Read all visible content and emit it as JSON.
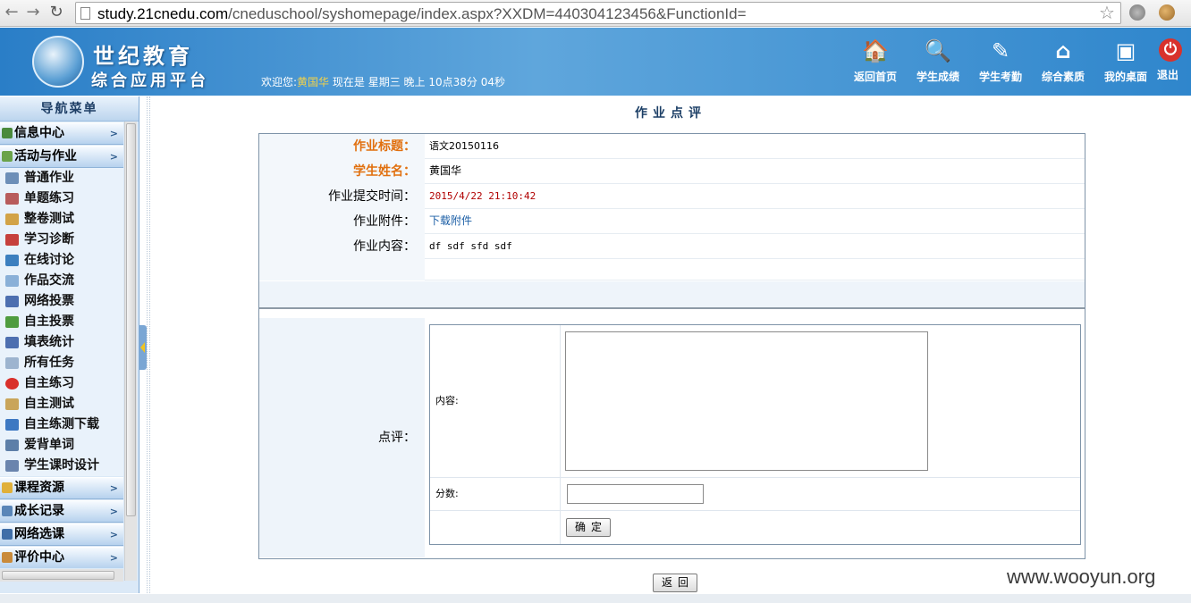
{
  "browser": {
    "url_host": "study.21cnedu.com",
    "url_rest": "/cneduschool/syshomepage/index.aspx?XXDM=440304123456&FunctionId=",
    "back": "←",
    "forward": "→",
    "reload": "↻",
    "star": "☆"
  },
  "header": {
    "logo_title": "世纪教育",
    "logo_subtitle": "综合应用平台",
    "welcome_prefix": "欢迎您:",
    "user_name": "黄国华",
    "welcome_suffix": "现在是 星期三 晚上 10点38分 04秒",
    "nav": [
      {
        "label": "返回首页",
        "icon": "🏠",
        "icon_name": "home-icon"
      },
      {
        "label": "学生成绩",
        "icon": "🔍",
        "icon_name": "grades-icon"
      },
      {
        "label": "学生考勤",
        "icon": "✎",
        "icon_name": "attendance-icon"
      },
      {
        "label": "综合素质",
        "icon": "⌂",
        "icon_name": "quality-icon"
      },
      {
        "label": "我的桌面",
        "icon": "▣",
        "icon_name": "desktop-icon"
      },
      {
        "label": "退出",
        "icon": "⏻",
        "icon_name": "power-icon"
      }
    ]
  },
  "sidebar": {
    "title": "导航菜单",
    "arrow": ">",
    "cats": {
      "info": "信息中心",
      "activity": "活动与作业",
      "course": "课程资源",
      "growth": "成长记录",
      "online": "网络选课",
      "eval": "评价中心"
    },
    "items": [
      "普通作业",
      "单题练习",
      "整卷测试",
      "学习诊断",
      "在线讨论",
      "作品交流",
      "网络投票",
      "自主投票",
      "填表统计",
      "所有任务",
      "自主练习",
      "自主测试",
      "自主练测下载",
      "爱背单词",
      "学生课时设计"
    ]
  },
  "main": {
    "page_title": "作业点评",
    "fields": {
      "title_label": "作业标题：",
      "title_value": "语文20150116",
      "student_label": "学生姓名：",
      "student_value": "黄国华",
      "time_label": "作业提交时间：",
      "time_value": "2015/4/22 21:10:42",
      "attach_label": "作业附件：",
      "attach_value": "下载附件",
      "content_label": "作业内容：",
      "content_value": "df sdf sfd sdf"
    },
    "review": {
      "label": "点评：",
      "content_label": "内容:",
      "score_label": "分数:",
      "content_value": "",
      "score_value": "",
      "confirm": "确定"
    },
    "back_button": "返回"
  },
  "watermark": "www.wooyun.org"
}
